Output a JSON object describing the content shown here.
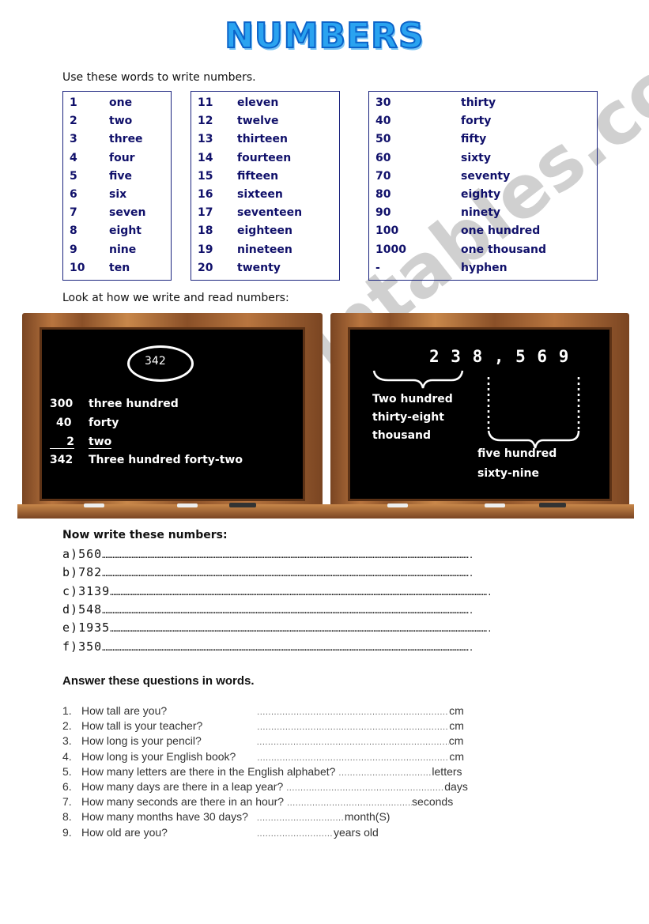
{
  "title": "NUMBERS",
  "intro": "Use these words to write numbers.",
  "word_boxes": [
    {
      "rows": [
        [
          "1",
          "one"
        ],
        [
          "2",
          "two"
        ],
        [
          "3",
          "three"
        ],
        [
          "4",
          "four"
        ],
        [
          "5",
          "five"
        ],
        [
          "6",
          "six"
        ],
        [
          "7",
          "seven"
        ],
        [
          "8",
          "eight"
        ],
        [
          "9",
          "nine"
        ],
        [
          "10",
          "ten"
        ]
      ]
    },
    {
      "rows": [
        [
          "11",
          "eleven"
        ],
        [
          "12",
          "twelve"
        ],
        [
          "13",
          "thirteen"
        ],
        [
          "14",
          "fourteen"
        ],
        [
          "15",
          "fifteen"
        ],
        [
          "16",
          "sixteen"
        ],
        [
          "17",
          "seventeen"
        ],
        [
          "18",
          "eighteen"
        ],
        [
          "19",
          "nineteen"
        ],
        [
          "20",
          "twenty"
        ]
      ]
    },
    {
      "rows": [
        [
          "30",
          "thirty"
        ],
        [
          "40",
          "forty"
        ],
        [
          "50",
          "fifty"
        ],
        [
          "60",
          "sixty"
        ],
        [
          "70",
          "seventy"
        ],
        [
          "80",
          "eighty"
        ],
        [
          "90",
          "ninety"
        ],
        [
          "100",
          "one hundred"
        ],
        [
          "1000",
          "one thousand"
        ],
        [
          " -",
          "hyphen"
        ]
      ]
    }
  ],
  "look_heading": "Look at how we write and read numbers:",
  "board1": {
    "circled": "342",
    "lines": [
      [
        "300",
        "three hundred"
      ],
      [
        "40",
        "forty"
      ],
      [
        "2",
        "two"
      ],
      [
        "342",
        "Three hundred forty-two"
      ]
    ]
  },
  "board2": {
    "number": "2 3 8 , 5 6 9",
    "left_label": [
      "Two hundred",
      "thirty-eight",
      "thousand"
    ],
    "right_label": [
      "five hundred",
      "sixty-nine"
    ]
  },
  "write_heading": "Now write these numbers:",
  "exercises": [
    {
      "label": "a)",
      "number": "560"
    },
    {
      "label": "b)",
      "number": "782"
    },
    {
      "label": "c)",
      "number": "3139"
    },
    {
      "label": "d)",
      "number": "548"
    },
    {
      "label": "e)",
      "number": "1935"
    },
    {
      "label": "f)",
      "number": "350"
    }
  ],
  "answer_heading": "Answer these questions in words.",
  "questions": [
    {
      "n": "1.",
      "text": "How tall are you?",
      "unit": "cm"
    },
    {
      "n": "2.",
      "text": "How tall is your teacher?",
      "unit": "cm"
    },
    {
      "n": "3.",
      "text": "How long is your pencil?",
      "unit": "cm"
    },
    {
      "n": "4.",
      "text": "How long is your English book?",
      "unit": "cm"
    },
    {
      "n": "5.",
      "text": "How many letters are there in the English alphabet?",
      "unit": "letters"
    },
    {
      "n": "6.",
      "text": "How many days are there in a leap year?",
      "unit": "days"
    },
    {
      "n": "7.",
      "text": "How many seconds are there in an hour?",
      "unit": "seconds"
    },
    {
      "n": "8.",
      "text": "How many months have 30 days?",
      "unit": "month(S)"
    },
    {
      "n": "9.",
      "text": "How old are you?",
      "unit": "years old"
    }
  ],
  "watermark": "ESLprintables.com"
}
